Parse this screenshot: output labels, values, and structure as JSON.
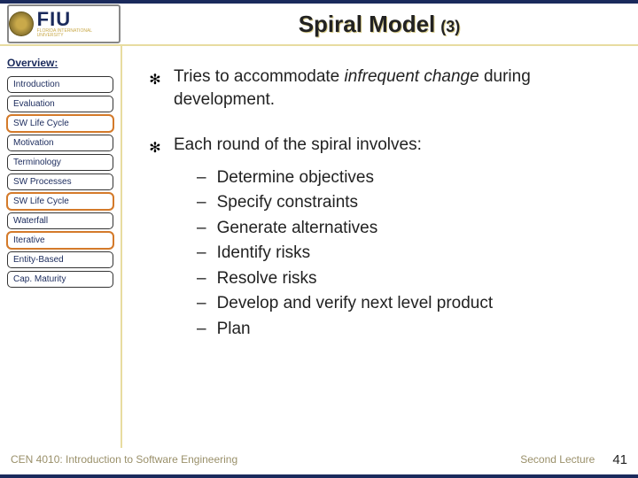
{
  "header": {
    "logo_big": "FIU",
    "logo_small": "FLORIDA INTERNATIONAL UNIVERSITY",
    "title_main": "Spiral Model",
    "title_sub": "(3)"
  },
  "sidebar": {
    "label": "Overview:",
    "items": [
      {
        "label": "Introduction",
        "active": false
      },
      {
        "label": "Evaluation",
        "active": false
      },
      {
        "label": "SW Life Cycle",
        "active": true
      },
      {
        "label": "Motivation",
        "active": false
      },
      {
        "label": "Terminology",
        "active": false
      },
      {
        "label": "SW Processes",
        "active": false
      },
      {
        "label": "SW Life Cycle",
        "active": true
      },
      {
        "label": "Waterfall",
        "active": false
      },
      {
        "label": "Iterative",
        "active": true
      },
      {
        "label": "Entity-Based",
        "active": false
      },
      {
        "label": "Cap. Maturity",
        "active": false
      }
    ]
  },
  "content": {
    "point1_pre": "Tries to accommodate ",
    "point1_em": "infrequent change",
    "point1_post": " during development.",
    "point2": "Each round of the spiral involves:",
    "subitems": [
      "Determine objectives",
      "Specify constraints",
      "Generate alternatives",
      "Identify risks",
      "Resolve risks",
      "Develop and verify next level product",
      "Plan"
    ]
  },
  "footer": {
    "left": "CEN 4010: Introduction to Software Engineering",
    "right": "Second Lecture",
    "page": "41"
  }
}
